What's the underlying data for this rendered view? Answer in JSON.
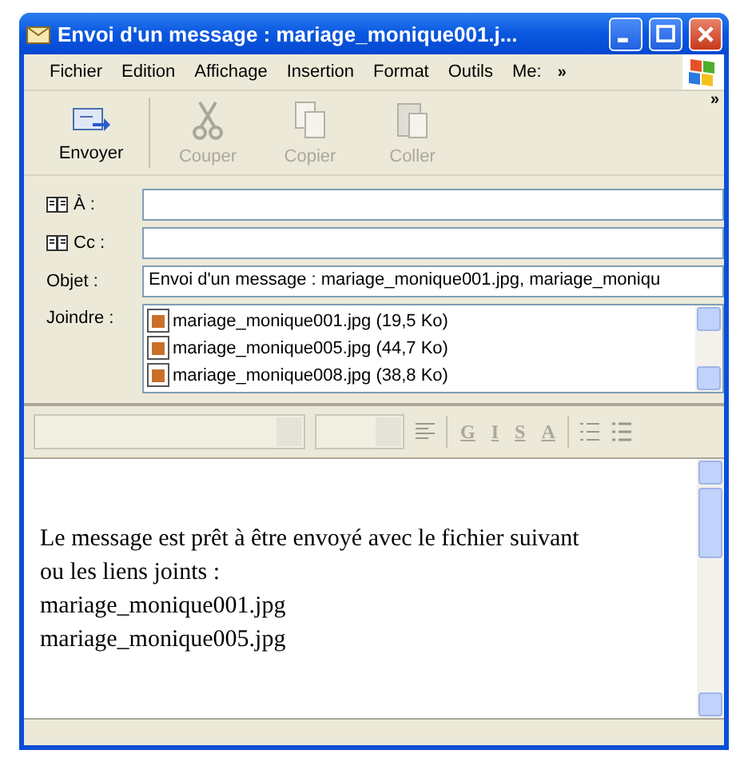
{
  "window": {
    "title": "Envoi d'un message : mariage_monique001.j..."
  },
  "menu": {
    "items": [
      "Fichier",
      "Edition",
      "Affichage",
      "Insertion",
      "Format",
      "Outils",
      "Me:"
    ],
    "overflow": "»"
  },
  "toolbar": {
    "buttons": [
      {
        "label": "Envoyer",
        "kind": "send",
        "disabled": false
      },
      {
        "label": "Couper",
        "kind": "cut",
        "disabled": true
      },
      {
        "label": "Copier",
        "kind": "copy",
        "disabled": true
      },
      {
        "label": "Coller",
        "kind": "paste",
        "disabled": true
      }
    ],
    "overflow": "»"
  },
  "header": {
    "fields": [
      {
        "label": "À :",
        "kind": "address"
      },
      {
        "label": "Cc :",
        "kind": "address"
      },
      {
        "label": "Objet :",
        "kind": "text",
        "value": "Envoi d'un message : mariage_monique001.jpg, mariage_moniqu"
      }
    ],
    "attachments_label": "Joindre :",
    "attachments": [
      "mariage_monique001.jpg (19,5 Ko)",
      "mariage_monique005.jpg (44,7 Ko)",
      "mariage_monique008.jpg (38,8 Ko)"
    ]
  },
  "format_bar": {
    "disabled": true,
    "buttons": [
      {
        "kind": "align"
      },
      {
        "kind": "letter",
        "label": "G"
      },
      {
        "kind": "letter",
        "label": "I"
      },
      {
        "kind": "letter",
        "label": "S"
      },
      {
        "kind": "letter",
        "label": "A"
      },
      {
        "kind": "numbered-list"
      },
      {
        "kind": "bullet-list"
      }
    ]
  },
  "body": {
    "lines": [
      "Le message est prêt à être envoyé avec le fichier suivant",
      "ou les liens joints :",
      "mariage_monique001.jpg",
      "mariage_monique005.jpg"
    ]
  }
}
